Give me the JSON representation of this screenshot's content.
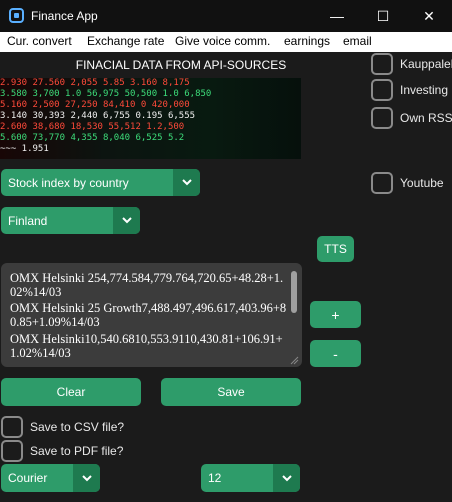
{
  "window": {
    "title": "Finance App",
    "controls": {
      "minimize": "—",
      "maximize": "☐",
      "close": "✕"
    }
  },
  "menu": [
    "Cur. convert",
    "Exchange rate",
    "Give voice comm.",
    "earnings",
    "email"
  ],
  "heading": "FINACIAL DATA FROM API-SOURCES",
  "banner": {
    "rows": [
      {
        "text": "   2.930    27.560  2,055   5.85   3.160  8,175"
      },
      {
        "text": "   3.580    3,700 1.0 56,975  50,500   1.0 6,850"
      },
      {
        "text": "   5.160    2,500  27,250  84,410  0  420,000"
      },
      {
        "text": "   3.140  30,393  2,440   6,755  0.195  6,555"
      },
      {
        "text": "   2.600  38,680  18,530  55,512  1.2,500"
      },
      {
        "text": "   5.600  73,770  4,355  8,040  6,525  5.2"
      },
      {
        "text": "                              ~~~  1.951"
      }
    ]
  },
  "stock_index_combo": {
    "value": "Stock index by country"
  },
  "country_combo": {
    "value": "Finland"
  },
  "tts_button": "TTS",
  "textbox_lines": [
    "OMX Helsinki 254,774.584,779.764,720.65+48.28+1.02%14/03",
    "OMX Helsinki 25 Growth7,488.497,496.617,403.96+80.85+1.09%14/03",
    "OMX Helsinki10,540.6810,553.9110,430.81+106.91+1.02%14/03"
  ],
  "plus_button": "+",
  "minus_button": "-",
  "clear_button": "Clear",
  "save_button": "Save",
  "checkboxes": {
    "csv": "Save to CSV file?",
    "pdf": "Save to PDF file?"
  },
  "side_checkboxes": [
    "Kauppalehti",
    "Investing",
    "Own RSS",
    "Youtube"
  ],
  "font_combo": {
    "value": "Courier"
  },
  "size_combo": {
    "value": "12"
  },
  "colors": {
    "background": "#1b1b1b",
    "accent": "#2e9c6a",
    "accent_dark": "#1e7a4f",
    "textbox": "#3c3c3c",
    "banner_red": "#ff4a3a",
    "banner_green": "#3ddc7a",
    "banner_white": "#f0f0f0"
  },
  "icons": {
    "app": "app-window-icon",
    "dropdown": "chevron-down-icon"
  }
}
